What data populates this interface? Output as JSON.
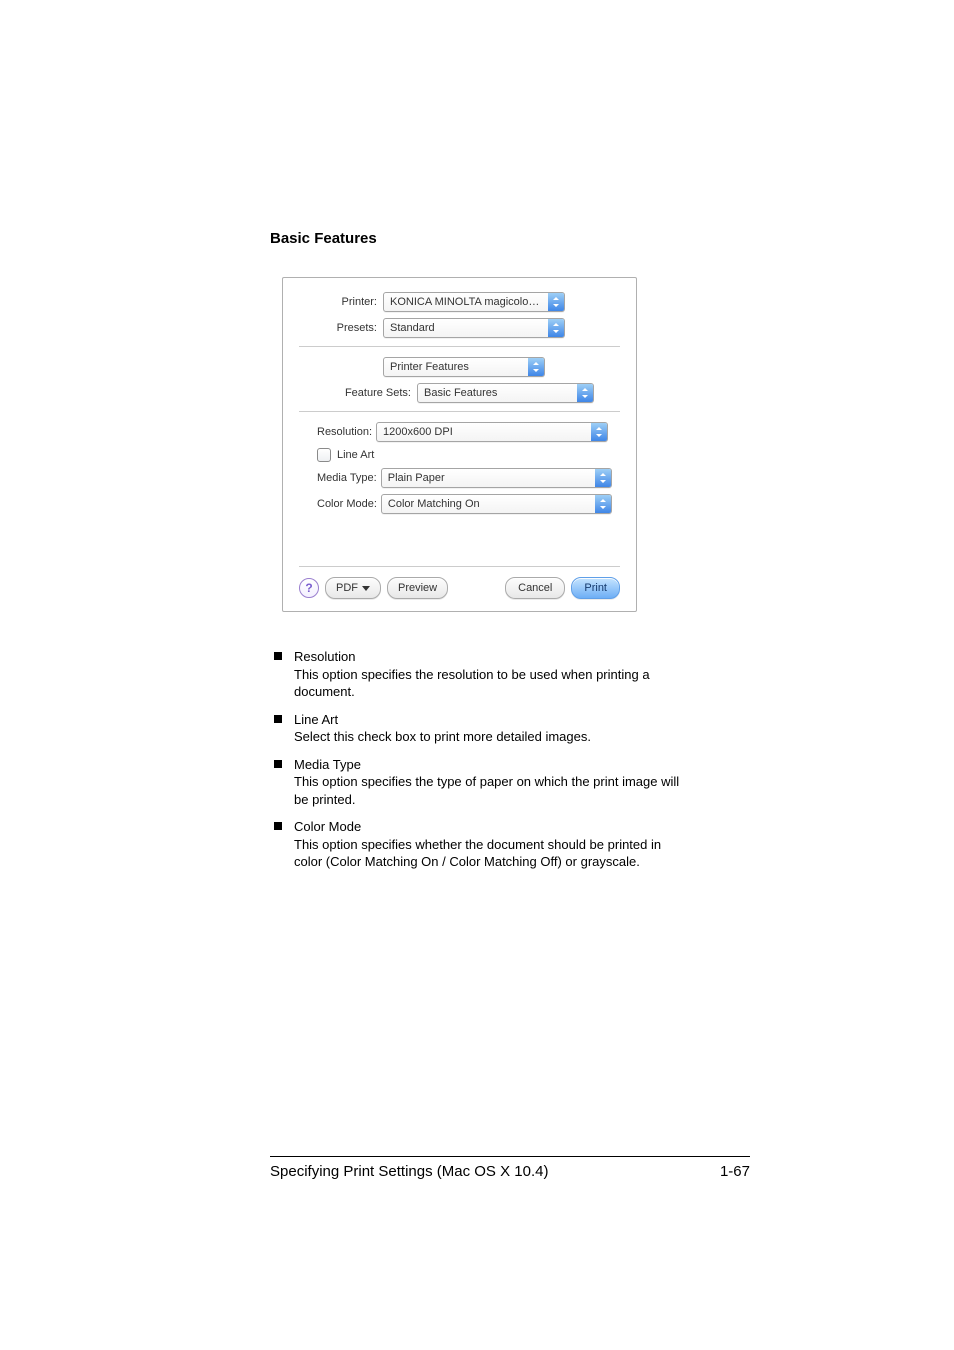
{
  "section_title": "Basic Features",
  "dialog": {
    "labels": {
      "printer": "Printer:",
      "presets": "Presets:",
      "feature_sets": "Feature Sets:"
    },
    "printer": "KONICA MINOLTA magicolor ...",
    "presets": "Standard",
    "panel": "Printer Features",
    "feature_set": "Basic Features",
    "options": {
      "resolution": {
        "label": "Resolution:",
        "value": "1200x600 DPI"
      },
      "line_art": {
        "label": "Line Art",
        "checked": false
      },
      "media_type": {
        "label": "Media Type:",
        "value": "Plain Paper"
      },
      "color_mode": {
        "label": "Color Mode:",
        "value": "Color Matching On"
      }
    },
    "buttons": {
      "help": "?",
      "pdf": "PDF",
      "preview": "Preview",
      "cancel": "Cancel",
      "print": "Print"
    }
  },
  "bullets": [
    {
      "head": "Resolution",
      "body": "This option specifies the resolution to be used when printing a document."
    },
    {
      "head": "Line Art",
      "body": "Select this check box to print more detailed images."
    },
    {
      "head": "Media Type",
      "body": "This option specifies the type of paper on which the print image will be printed."
    },
    {
      "head": "Color Mode",
      "body": "This option specifies whether the document should be printed in color (Color Matching On / Color Matching Off) or grayscale."
    }
  ],
  "footer": {
    "text": "Specifying Print Settings (Mac OS X 10.4)",
    "page": "1-67"
  }
}
